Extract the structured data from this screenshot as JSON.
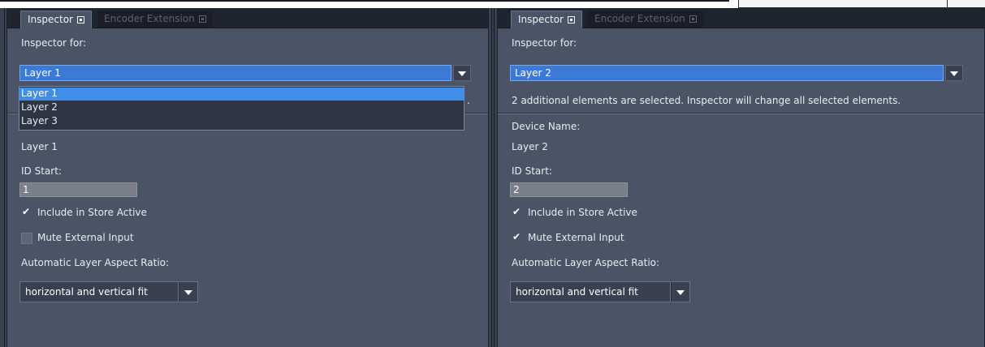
{
  "left": {
    "tabs": [
      {
        "label": "Inspector"
      },
      {
        "label": "Encoder Extension"
      }
    ],
    "inspector_for_label": "Inspector for:",
    "layer_select": {
      "value": "Layer 1"
    },
    "dropdown_options": [
      "Layer 1",
      "Layer 2",
      "Layer 3"
    ],
    "truncated_message_tail": ".",
    "device_name_value": "Layer 1",
    "id_start_label": "ID Start:",
    "id_start_value": "1",
    "include_store": {
      "label": "Include in Store Active",
      "checked": true
    },
    "mute_input": {
      "label": "Mute External Input",
      "checked": false
    },
    "aspect_label": "Automatic Layer Aspect Ratio:",
    "aspect_value": "horizontal and vertical fit"
  },
  "right": {
    "tabs": [
      {
        "label": "Inspector"
      },
      {
        "label": "Encoder Extension"
      }
    ],
    "inspector_for_label": "Inspector for:",
    "layer_select": {
      "value": "Layer 2"
    },
    "info_message": "2 additional elements are selected. Inspector will change all selected elements.",
    "device_name_label": "Device Name:",
    "device_name_value": "Layer 2",
    "id_start_label": "ID Start:",
    "id_start_value": "2",
    "include_store": {
      "label": "Include in Store Active",
      "checked": true
    },
    "mute_input": {
      "label": "Mute External Input",
      "checked": true
    },
    "aspect_label": "Automatic Layer Aspect Ratio:",
    "aspect_value": "horizontal and vertical fit"
  },
  "icons": {
    "check": "✔",
    "tab_close": "close-box-icon",
    "dropdown": "triangle-down-icon"
  },
  "colors": {
    "panel_bg": "#4b5467",
    "selection_blue": "#3c7ad6",
    "dropdown_highlight": "#3f8eea"
  }
}
